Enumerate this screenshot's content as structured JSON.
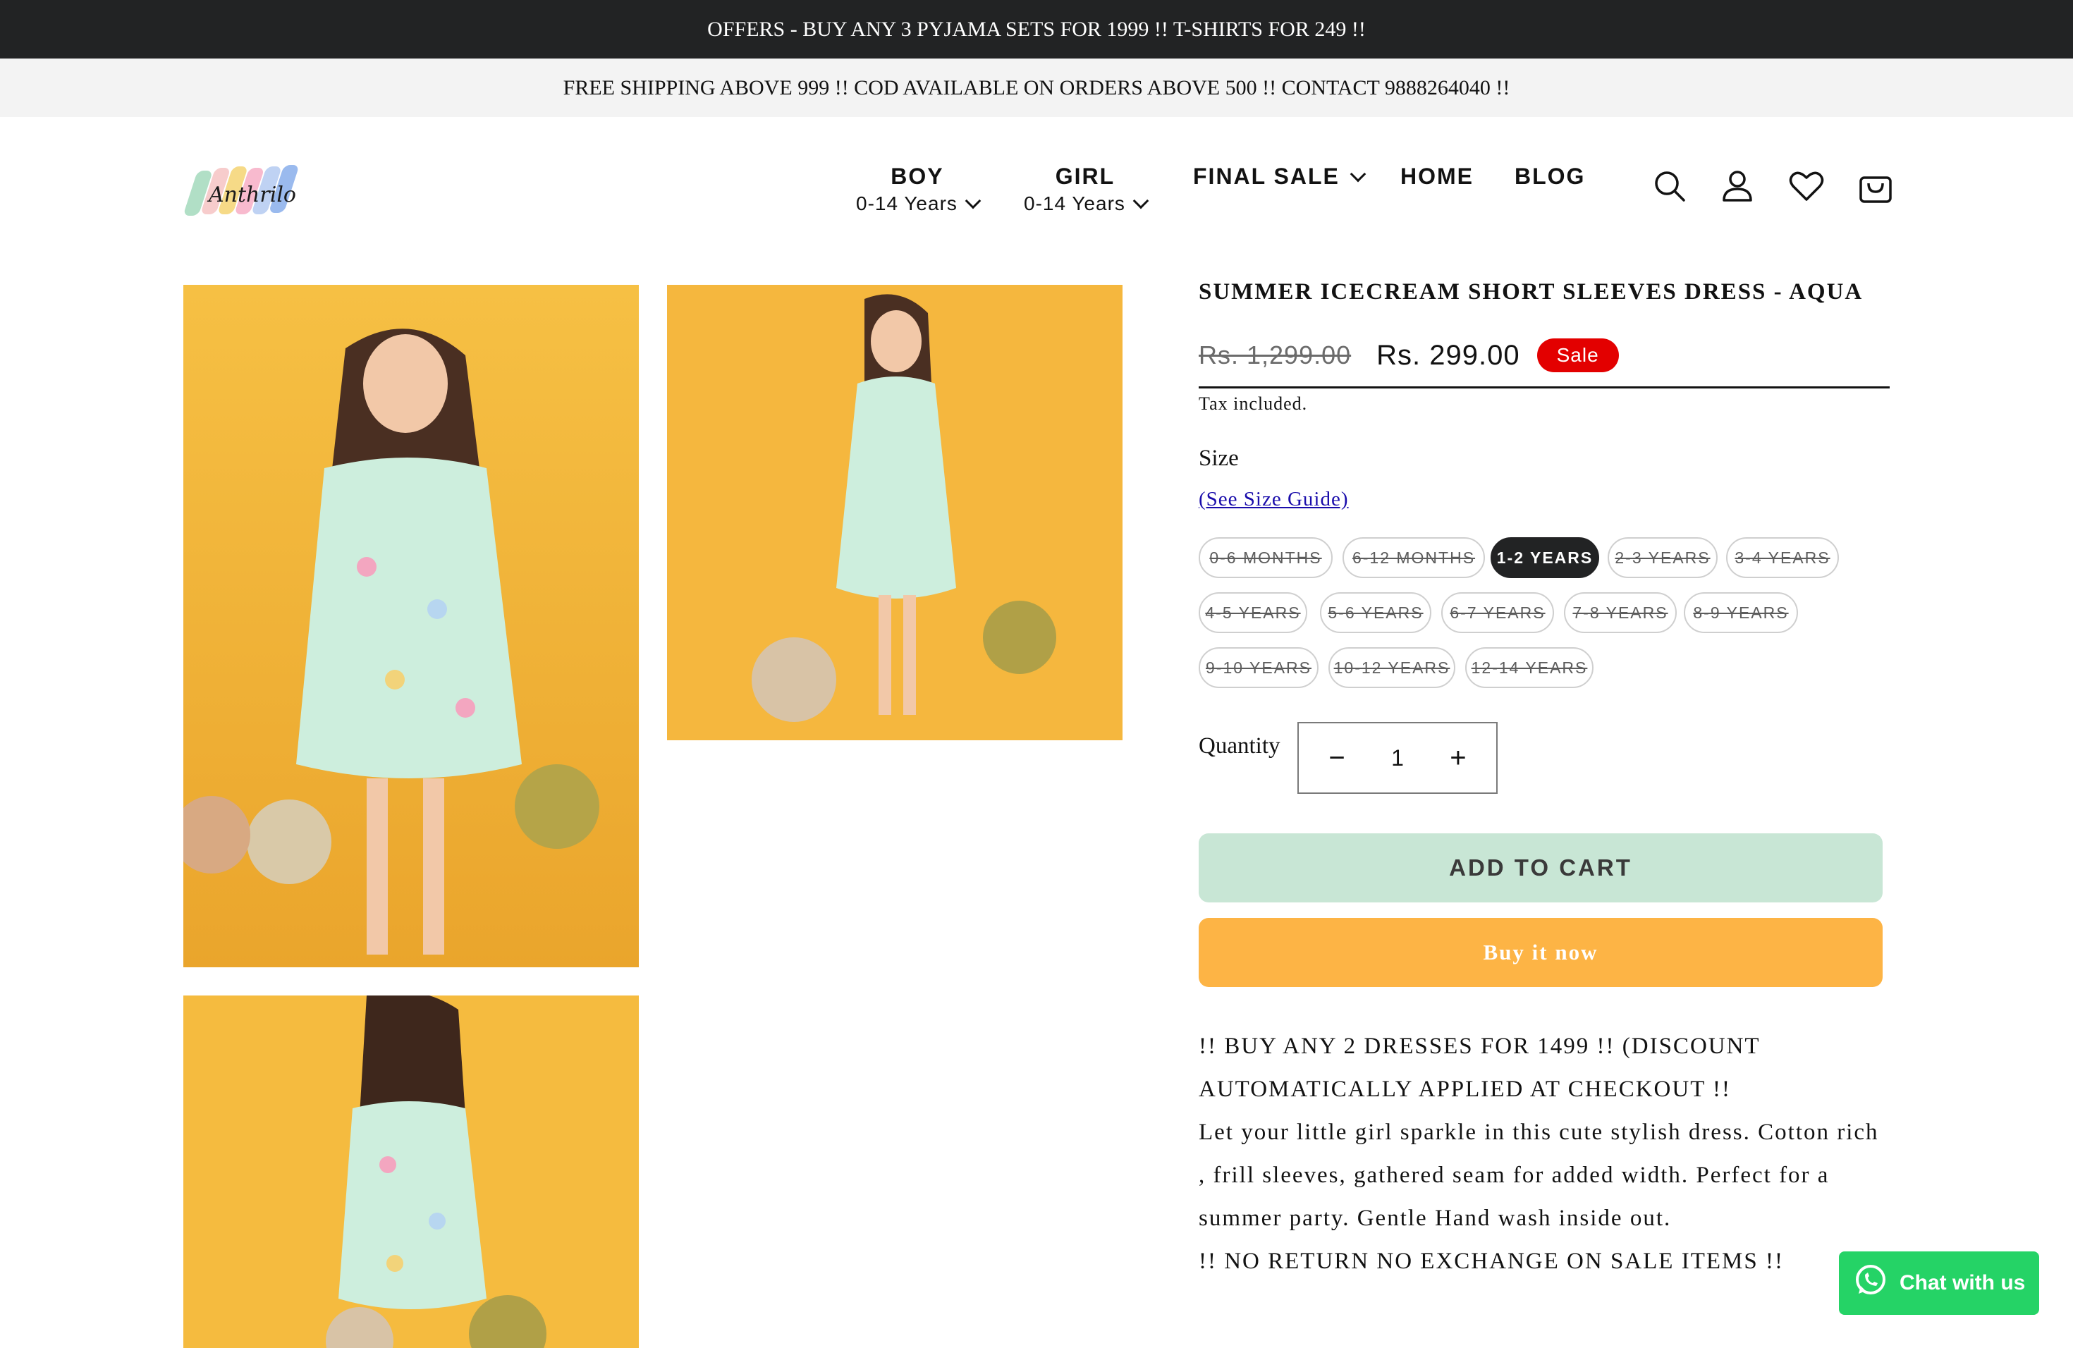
{
  "announcement": {
    "offers": "OFFERS - BUY ANY 3 PYJAMA SETS FOR 1999 !! T-SHIRTS FOR 249 !!",
    "shipping": "FREE SHIPPING ABOVE 999 !! COD AVAILABLE ON ORDERS ABOVE 500 !! CONTACT 9888264040 !!"
  },
  "header": {
    "logo_text": "Anthrilo",
    "nav": [
      {
        "label": "BOY",
        "sub": "0-14 Years"
      },
      {
        "label": "GIRL",
        "sub": "0-14 Years"
      },
      {
        "label": "FINAL SALE"
      },
      {
        "label": "HOME"
      },
      {
        "label": "BLOG"
      }
    ],
    "icons": [
      "search-icon",
      "account-icon",
      "wishlist-icon",
      "cart-icon"
    ]
  },
  "product": {
    "title": "SUMMER ICECREAM SHORT SLEEVES DRESS - AQUA",
    "price_regular": "Rs. 1,299.00",
    "price_sale": "Rs. 299.00",
    "sale_badge": "Sale",
    "tax_note": "Tax included.",
    "size_label": "Size",
    "size_guide": "(See Size Guide)",
    "sizes": [
      "0-6 MONTHS",
      "6-12 MONTHS",
      "1-2 YEARS",
      "2-3 YEARS",
      "3-4 YEARS",
      "4-5 YEARS",
      "5-6 YEARS",
      "6-7 YEARS",
      "7-8 YEARS",
      "8-9 YEARS",
      "9-10 YEARS",
      "10-12 YEARS",
      "12-14 YEARS"
    ],
    "selected_size": "1-2 YEARS",
    "quantity_label": "Quantity",
    "quantity": "1",
    "add_to_cart": "ADD TO CART",
    "buy_now": "Buy it now",
    "description": [
      "!! BUY ANY 2 DRESSES FOR 1499 !! (DISCOUNT AUTOMATICALLY APPLIED AT CHECKOUT !!",
      "Let your little girl sparkle in this cute stylish dress. Cotton rich , frill sleeves, gathered seam for added width. Perfect for a summer party. Gentle Hand wash inside out.",
      "!! NO RETURN NO EXCHANGE ON SALE ITEMS !!"
    ]
  },
  "chat": {
    "label": "Chat with us"
  },
  "colors": {
    "top_bar": "#222324",
    "sale": "#e30000",
    "add_to_cart": "#c8e6d5",
    "buy_now": "#fdb445",
    "chat": "#25d366"
  }
}
